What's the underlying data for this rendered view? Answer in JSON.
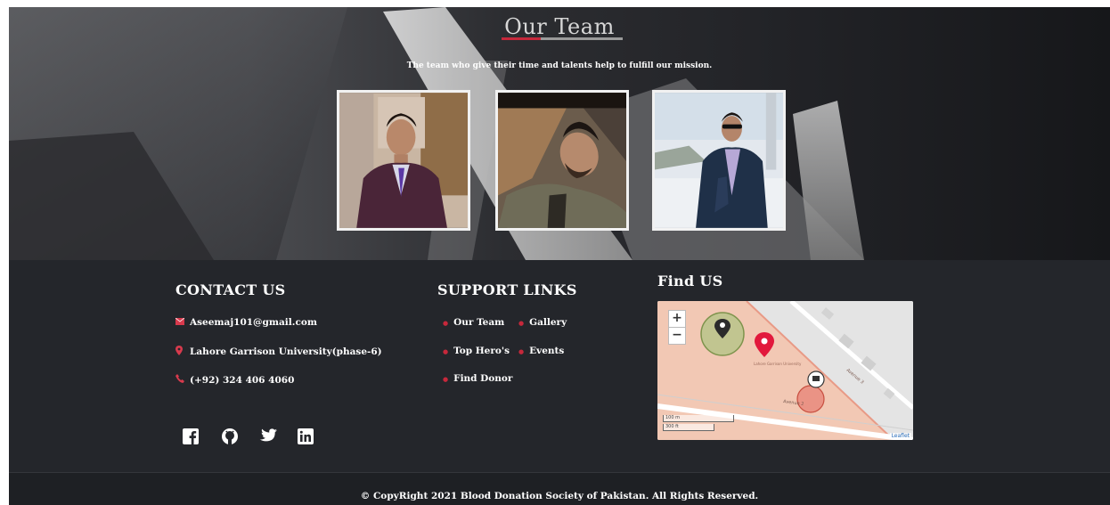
{
  "team": {
    "title": "Our Team",
    "subtitle": "The team who give their time and talents help to fulfill our mission.",
    "members": [
      {
        "photo": "member-photo-suit"
      },
      {
        "photo": "member-photo-selfie"
      },
      {
        "photo": "member-photo-jacket"
      }
    ]
  },
  "contact": {
    "heading": "CONTACT US",
    "email": "Aseemaj101@gmail.com",
    "address": "Lahore Garrison University(phase-6)",
    "phone": "(+92) 324 406 4060",
    "icons": {
      "email": "envelope-icon",
      "address": "map-pin-icon",
      "phone": "phone-icon"
    }
  },
  "support": {
    "heading": "SUPPORT LINKS",
    "links": [
      "Our Team",
      "Gallery",
      "Top Hero's",
      "Events",
      "Find Donor"
    ]
  },
  "social": [
    "facebook-icon",
    "github-icon",
    "twitter-icon",
    "linkedin-icon"
  ],
  "find_us": {
    "heading": "Find US",
    "zoom_in": "+",
    "zoom_out": "−",
    "scale_metric": "100 m",
    "scale_imperial": "300 ft",
    "attribution": "Leaflet",
    "street_label_1": "Avenue 3",
    "street_label_2": "Avenue 2",
    "place_label": "Lahore Garrison University"
  },
  "footer": {
    "copyright": "© CopyRight 2021  Blood Donation Society of Pakistan. All Rights Reserved."
  },
  "colors": {
    "accent": "#c6283b",
    "footer_bg": "#24262b",
    "copyright_bg": "#1e2024"
  }
}
